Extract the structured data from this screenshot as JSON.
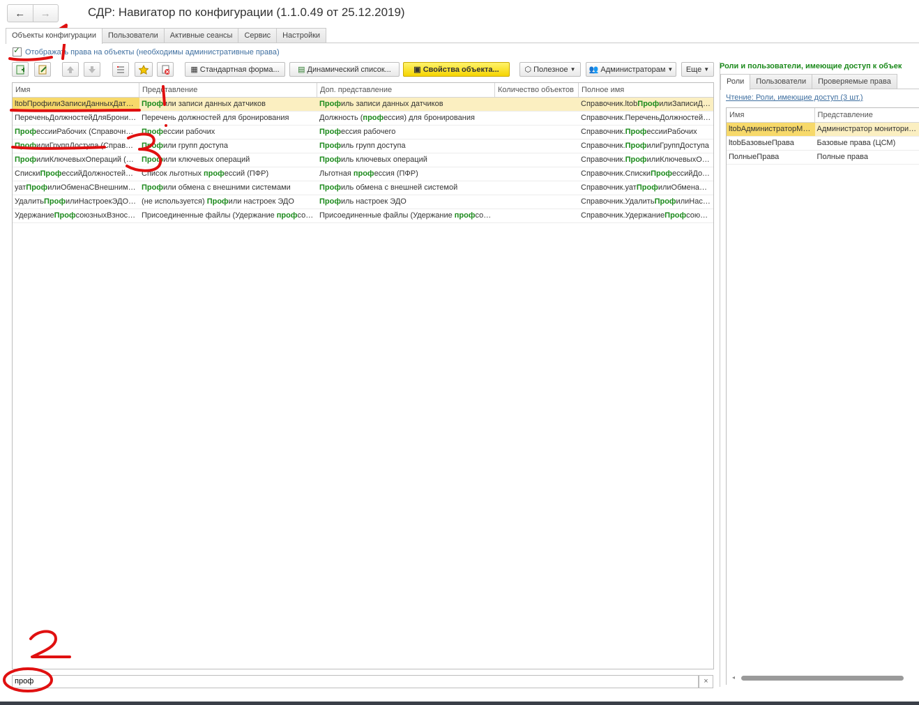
{
  "nav": {
    "back_icon": "←",
    "forward_icon": "→"
  },
  "window_title": "СДР: Навигатор по конфигурации (1.1.0.49 от 25.12.2019)",
  "tabs": [
    "Объекты конфигурации",
    "Пользователи",
    "Активные сеансы",
    "Сервис",
    "Настройки"
  ],
  "checkbox_label": "Отображать права на объекты (необходимы административные права)",
  "toolbar": {
    "standard_form": "Стандартная форма...",
    "dynamic_list": "Динамический список...",
    "object_properties": "Свойства объекта...",
    "useful": "Полезное",
    "administrators": "Администраторам",
    "more": "Еще"
  },
  "grid": {
    "headers": [
      "Имя",
      "Представление",
      "Доп. представление",
      "Количество объектов",
      "Полное имя"
    ],
    "rows": [
      {
        "c0": "ltobПрофилиЗаписиДанныхДатч…",
        "c1": "Профили записи данных датчиков",
        "c2": "Профиль записи данных датчиков",
        "c3": "",
        "c4": "Справочник.ltobПрофилиЗаписиДа…"
      },
      {
        "c0": "ПереченьДолжностейДляБрони…",
        "c1": "Перечень должностей для бронирования",
        "c2": "Должность (профессия) для бронирования",
        "c3": "",
        "c4": "Справочник.ПереченьДолжностей…"
      },
      {
        "c0": "ПрофессииРабочих (Справочн…",
        "c1": "Профессии рабочих",
        "c2": "Профессия рабочего",
        "c3": "",
        "c4": "Справочник.ПрофессииРабочих"
      },
      {
        "c0": "ПрофилиГруппДоступа (Справо…",
        "c1": "Профили групп доступа",
        "c2": "Профиль групп доступа",
        "c3": "",
        "c4": "Справочник.ПрофилиГруппДоступа"
      },
      {
        "c0": "ПрофилиКлючевыхОпераций (С…",
        "c1": "Профили ключевых операций",
        "c2": "Профиль ключевых операций",
        "c3": "",
        "c4": "Справочник.ПрофилиКлючевыхОп…"
      },
      {
        "c0": "СпискиПрофессийДолжностейЛ…",
        "c1": "Список льготных профессий (ПФР)",
        "c2": "Льготная профессия (ПФР)",
        "c3": "",
        "c4": "Справочник.СпискиПрофессийДол…"
      },
      {
        "c0": "уатПрофилиОбменаСВнешними…",
        "c1": "Профили обмена с внешними системами",
        "c2": "Профиль обмена с внешней системой",
        "c3": "",
        "c4": "Справочник.уатПрофилиОбменаСВ…"
      },
      {
        "c0": "УдалитьПрофилиНастроекЭДО …",
        "c1": "(не используется) Профили настроек ЭДО",
        "c2": "Профиль настроек ЭДО",
        "c3": "",
        "c4": "Справочник.УдалитьПрофилиНаст…"
      },
      {
        "c0": "УдержаниеПрофсоюзныхВзнос…",
        "c1": "Присоединенные файлы (Удержание профсо…",
        "c2": "Присоединенные файлы (Удержание профсо…",
        "c3": "",
        "c4": "Справочник.УдержаниеПрофсоюз…"
      }
    ]
  },
  "search": {
    "value": "проф",
    "clear_icon": "×"
  },
  "right": {
    "title": "Роли и пользователи, имеющие доступ к объек",
    "tabs": [
      "Роли",
      "Пользователи",
      "Проверяемые права"
    ],
    "link": "Чтение: Роли, имеющие доступ (3 шт.)",
    "headers": [
      "Имя",
      "Представление"
    ],
    "rows": [
      {
        "name": "ltobАдминистраторМо…",
        "repr": "Администратор мониторинга"
      },
      {
        "name": "ltobБазовыеПрава",
        "repr": "Базовые права (ЦСМ)"
      },
      {
        "name": "ПолныеПрава",
        "repr": "Полные права"
      }
    ]
  },
  "annotations": [
    "1",
    "2",
    "3"
  ],
  "colors": {
    "highlight": "#1c8a1c",
    "selected_row": "#fbefc1",
    "accent_yellow": "#f5d400",
    "annotation": "#e01010"
  }
}
